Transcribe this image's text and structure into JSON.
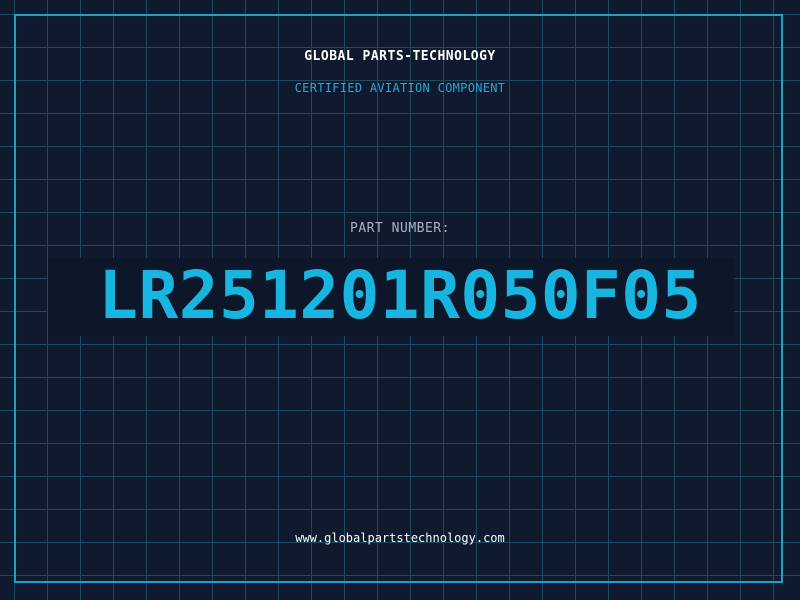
{
  "header": {
    "company_name": "GLOBAL PARTS-TECHNOLOGY",
    "subtitle": "CERTIFIED AVIATION COMPONENT"
  },
  "part": {
    "label": "PART NUMBER:",
    "number": "LR251201R050F05"
  },
  "footer": {
    "website": "www.globalpartstechnology.com"
  },
  "colors": {
    "background": "#0f1a2e",
    "grid": "#1d4a63",
    "frame": "#1aa0c9",
    "accent": "#17b5e0",
    "text_primary": "#ffffff",
    "text_muted": "#a7b4c4"
  }
}
